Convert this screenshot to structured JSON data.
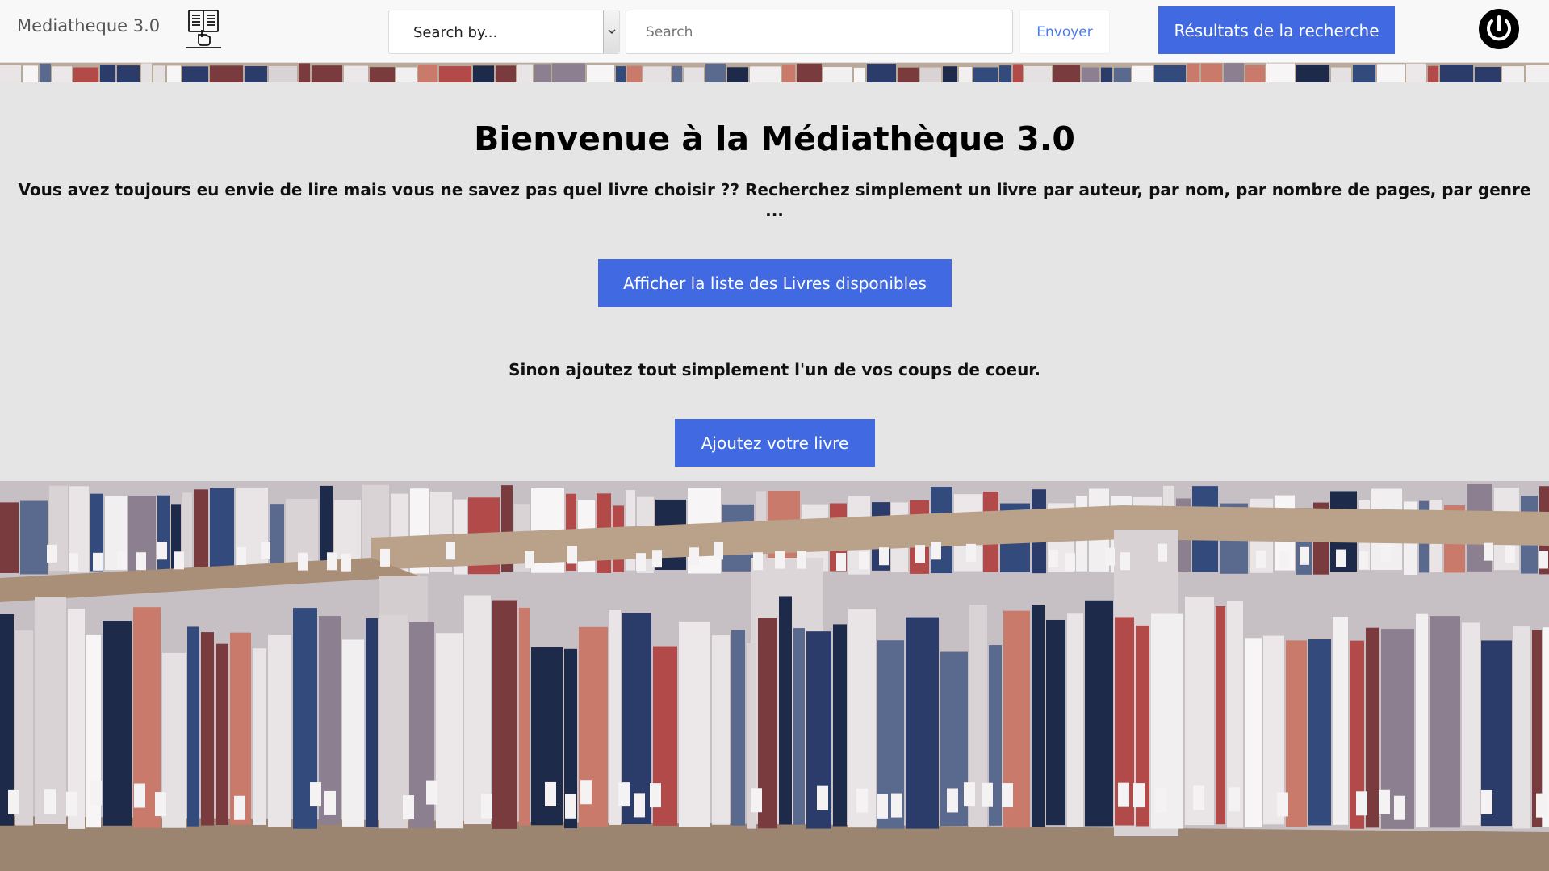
{
  "navbar": {
    "brand": "Mediatheque 3.0",
    "logo_icon": "book-reader-icon",
    "search_by": {
      "selected": "Search by..."
    },
    "search": {
      "placeholder": "Search",
      "value": ""
    },
    "send_label": "Envoyer",
    "results_label": "Résultats de la recherche",
    "power_icon": "power-icon"
  },
  "hero": {
    "title": "Bienvenue à la Médiathèque 3.0",
    "text": "Vous avez toujours eu envie de lire mais vous ne savez pas quel livre choisir ?? Recherchez simplement un livre par auteur, par nom, par nombre de pages, par genre ...",
    "list_button": "Afficher la liste des Livres disponibles",
    "subtext": "Sinon ajoutez tout simplement l'un de vos coups de coeur.",
    "add_button": "Ajoutez votre livre"
  },
  "background": {
    "image": "library-bookshelves-photo"
  },
  "colors": {
    "accent": "#4169e1",
    "hero_bg": "#e5e5e5",
    "navbar_bg": "#f8f8f8",
    "link": "#4a7be8"
  }
}
